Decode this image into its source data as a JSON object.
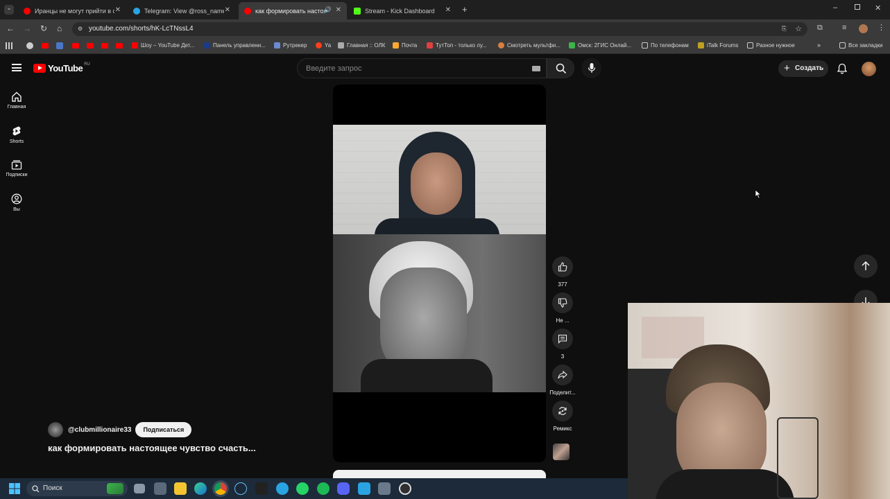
{
  "browser": {
    "tabs": [
      {
        "title": "Иранцы не могут прийти в се",
        "color": "#ff0000",
        "active": false
      },
      {
        "title": "Telegram: View @ross_name",
        "color": "#2aa3e2",
        "active": false
      },
      {
        "title": "как формировать настоящ",
        "color": "#ff0000",
        "active": true
      },
      {
        "title": "Stream - Kick Dashboard",
        "color": "#53fc18",
        "active": false
      }
    ],
    "url": "youtube.com/shorts/hK-LcTNssL4",
    "bookmarks": [
      "Шоу – YouTube Дет...",
      "Панель управлени...",
      "Рутрекер",
      "Ya",
      "Главная :: ОЛК",
      "Почта",
      "ТутТоп - только лу...",
      "Смотреть мультфи...",
      "Омск: 2ГИС Онлай...",
      "По телефонам",
      "iTalk Forums",
      "Разное нужное",
      "Все закладки"
    ]
  },
  "youtube": {
    "logo": "YouTube",
    "region": "RU",
    "search_placeholder": "Введите запрос",
    "create_label": "Создать",
    "sidebar": [
      {
        "label": "Главная",
        "icon": "home-icon"
      },
      {
        "label": "Shorts",
        "icon": "shorts-icon"
      },
      {
        "label": "Подписки",
        "icon": "subscriptions-icon"
      },
      {
        "label": "Вы",
        "icon": "you-icon"
      }
    ],
    "actions": {
      "like_count": "377",
      "dislike_label": "Не ...",
      "comments_count": "3",
      "share_label": "Поделит...",
      "remix_label": "Ремикс"
    },
    "channel": "@clubmillionaire33",
    "subscribe_label": "Подписаться",
    "video_title": "как формировать настоящее чувство счасть..."
  },
  "taskbar": {
    "search_label": "Поиск"
  },
  "colors": {
    "background": "#0f0f0f",
    "youtube_red": "#ff0000",
    "taskbar": "#1c2a3a"
  }
}
